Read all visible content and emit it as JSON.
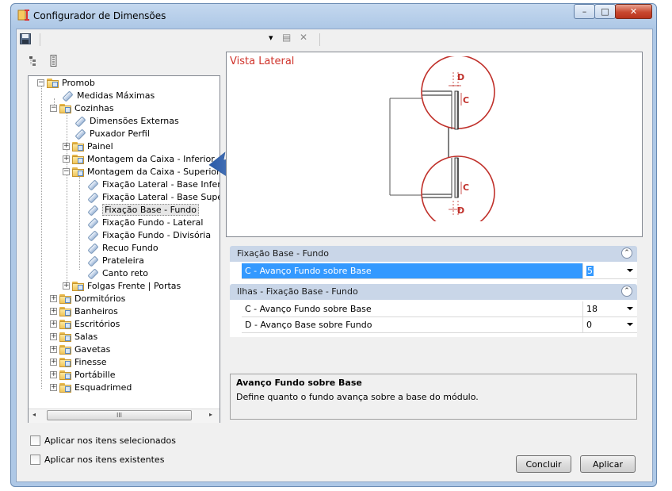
{
  "window": {
    "title": "Configurador de Dimensões",
    "min": "–",
    "max": "□",
    "close": "✕"
  },
  "toolbar": {
    "save_icon": "save-icon",
    "combo_value": "",
    "dropdown": "▾",
    "action1": "▤",
    "action2": "✕"
  },
  "tree": {
    "root": "Promob",
    "medidas": "Medidas Máximas",
    "cozinhas": "Cozinhas",
    "cozinhas_children": [
      "Dimensões Externas",
      "Puxador Perfil",
      "Painel",
      "Montagem da Caixa - Inferior",
      "Montagem da Caixa - Superior"
    ],
    "superior_children": [
      "Fixação Lateral - Base Inferior",
      "Fixação Lateral - Base Superior",
      "Fixação Base - Fundo",
      "Fixação Fundo - Lateral",
      "Fixação Fundo - Divisória",
      "Recuo Fundo",
      "Prateleira",
      "Canto reto"
    ],
    "folgas": "Folgas Frente | Portas",
    "categories": [
      "Dormitórios",
      "Banheiros",
      "Escritórios",
      "Salas",
      "Gavetas",
      "Finesse",
      "Portábille",
      "Esquadrimed"
    ],
    "scroll_thumb": "III"
  },
  "diagram": {
    "title": "Vista Lateral",
    "label_d": "D",
    "label_c": "C"
  },
  "grid": {
    "cat1": {
      "title": "Fixação Base - Fundo",
      "rows": [
        {
          "name": "C - Avanço Fundo sobre Base",
          "value": "5"
        }
      ]
    },
    "cat2": {
      "title": "Ilhas - Fixação Base - Fundo",
      "rows": [
        {
          "name": "C - Avanço Fundo sobre Base",
          "value": "18"
        },
        {
          "name": "D - Avanço Base sobre Fundo",
          "value": "0"
        }
      ]
    },
    "collapse_glyph": "⌃"
  },
  "help": {
    "title": "Avanço Fundo sobre Base",
    "desc": "Define quanto o fundo avança sobre a base do módulo."
  },
  "options": {
    "apply_selected": "Aplicar nos itens selecionados",
    "apply_existing": "Aplicar nos itens existentes"
  },
  "buttons": {
    "finish": "Concluir",
    "apply": "Aplicar"
  },
  "colors": {
    "accent": "#3399ff",
    "diagram_red": "#c0302a",
    "arrow_blue": "#3d6fb8"
  }
}
